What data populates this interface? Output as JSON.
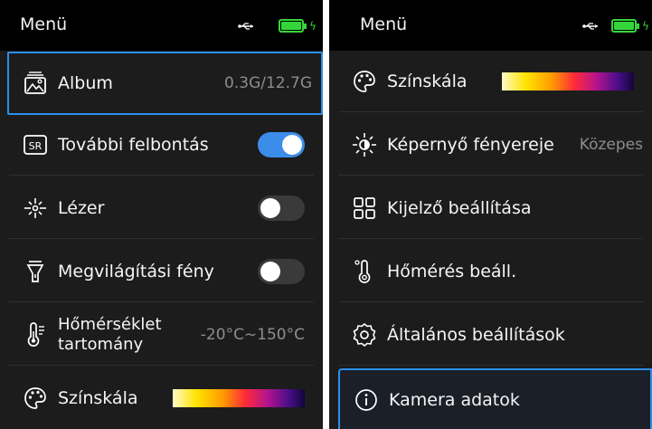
{
  "colors": {
    "panel_bg": "#1c1c1c",
    "header_bg": "#000000",
    "accent": "#2b8ee8",
    "battery": "#34d63a",
    "toggle_on": "#3c8dea",
    "toggle_off": "#3a3a3a"
  },
  "left": {
    "title": "Menü",
    "items": [
      {
        "label": "Album",
        "value": "0.3G/12.7G",
        "icon": "album-icon",
        "selected": true
      },
      {
        "label": "További felbontás",
        "icon": "sr-icon",
        "toggle": "on"
      },
      {
        "label": "Lézer",
        "icon": "laser-icon",
        "toggle": "off"
      },
      {
        "label": "Megvilágítási fény",
        "icon": "flashlight-icon",
        "toggle": "off"
      },
      {
        "label": "Hőmérséklet tartomány",
        "value": "-20°C~150°C",
        "icon": "thermometer-range-icon"
      },
      {
        "label": "Színskála",
        "icon": "palette-icon"
      }
    ]
  },
  "right": {
    "title": "Menü",
    "items": [
      {
        "label": "Színskála",
        "icon": "palette-icon"
      },
      {
        "label": "Képernyő fényereje",
        "value": "Közepes",
        "icon": "brightness-icon"
      },
      {
        "label": "Kijelző beállítása",
        "icon": "display-grid-icon"
      },
      {
        "label": "Hőmérés beáll.",
        "icon": "thermometer-icon"
      },
      {
        "label": "Általános beállítások",
        "icon": "gear-icon"
      },
      {
        "label": "Kamera adatok",
        "icon": "info-icon",
        "selected": true
      }
    ]
  }
}
